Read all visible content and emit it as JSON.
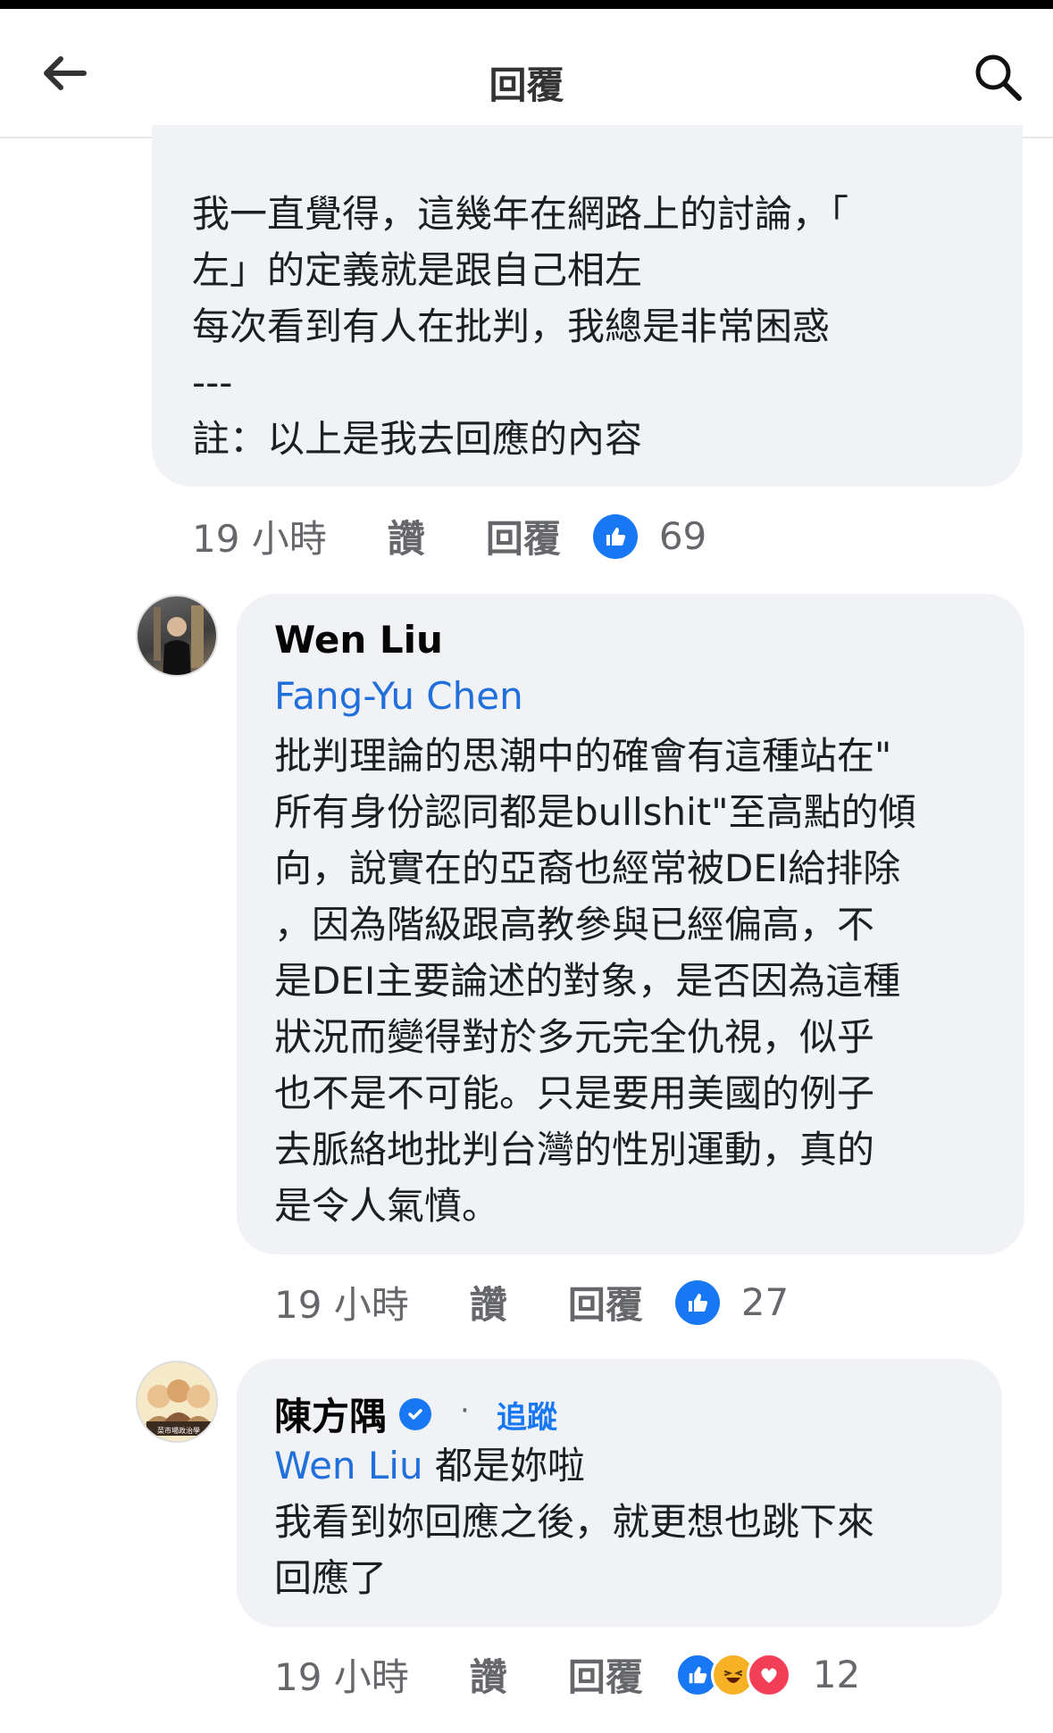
{
  "header": {
    "title": "回覆",
    "back_icon": "arrow-left-icon",
    "search_icon": "search-icon"
  },
  "comment1": {
    "text": "我一直覺得，這幾年在網路上的討論，「\n左」的定義就是跟自己相左\n每次看到有人在批判，我總是非常困惑\n---\n註：以上是我去回應的內容",
    "time": "19 小時",
    "like_label": "讚",
    "reply_label": "回覆",
    "reaction_count": "69"
  },
  "comment2": {
    "author": "Wen Liu",
    "mention": "Fang-Yu Chen",
    "text": "批判理論的思潮中的確會有這種站在\"\n所有身份認同都是bullshit\"至高點的傾\n向，說實在的亞裔也經常被DEI給排除\n，因為階級跟高教參與已經偏高，不\n是DEI主要論述的對象，是否因為這種\n狀況而變得對於多元完全仇視，似乎\n也不是不可能。只是要用美國的例子\n去脈絡地批判台灣的性別運動，真的\n是令人氣憤。",
    "time": "19 小時",
    "like_label": "讚",
    "reply_label": "回覆",
    "reaction_count": "27"
  },
  "comment3": {
    "author": "陳方隅",
    "separator": "·",
    "follow_label": "追蹤",
    "mention": "Wen Liu",
    "mention_rest": " 都是妳啦",
    "text": "我看到妳回應之後，就更想也跳下來\n回應了",
    "time": "19 小時",
    "like_label": "讚",
    "reply_label": "回覆",
    "reaction_count": "12",
    "avatar_badge": "菜市場政治學"
  },
  "colors": {
    "accent": "#1877f2",
    "bubble": "#f0f2f5",
    "meta_text": "#65676b"
  }
}
